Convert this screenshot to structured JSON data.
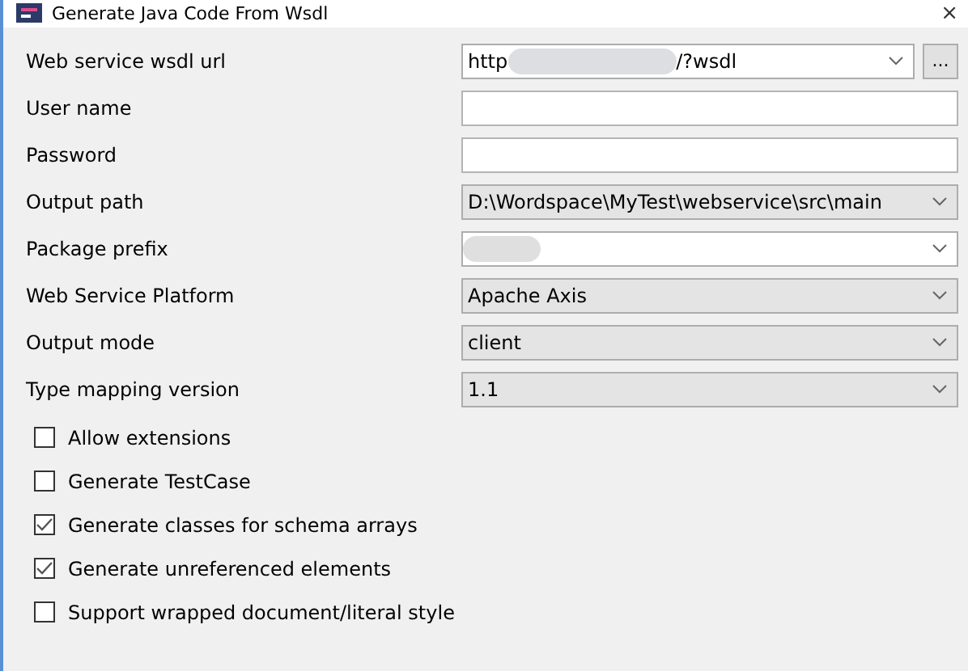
{
  "window": {
    "title": "Generate Java Code From Wsdl",
    "close": "×"
  },
  "fields": [
    {
      "label": "Web service wsdl url",
      "kind": "url-combo",
      "value_start": "http",
      "value_end": "/?wsdl",
      "redacted": true,
      "browse": "..."
    },
    {
      "label": "User name",
      "kind": "text"
    },
    {
      "label": "Password",
      "kind": "text"
    },
    {
      "label": "Output path",
      "kind": "combo",
      "value": "D:\\Wordspace\\MyTest\\webservice\\src\\main"
    },
    {
      "label": "Package prefix",
      "kind": "editable-combo",
      "redacted": true
    },
    {
      "label": "Web Service Platform",
      "kind": "combo",
      "value": "Apache Axis"
    },
    {
      "label": "Output mode",
      "kind": "combo",
      "value": "client"
    },
    {
      "label": "Type mapping version",
      "kind": "combo",
      "value": "1.1"
    }
  ],
  "options": [
    {
      "label": "Allow extensions",
      "checked": false
    },
    {
      "label": "Generate TestCase",
      "checked": false
    },
    {
      "label": "Generate classes for schema arrays",
      "checked": true
    },
    {
      "label": "Generate unreferenced elements",
      "checked": true
    },
    {
      "label": "Support wrapped document/literal style",
      "checked": false
    }
  ]
}
